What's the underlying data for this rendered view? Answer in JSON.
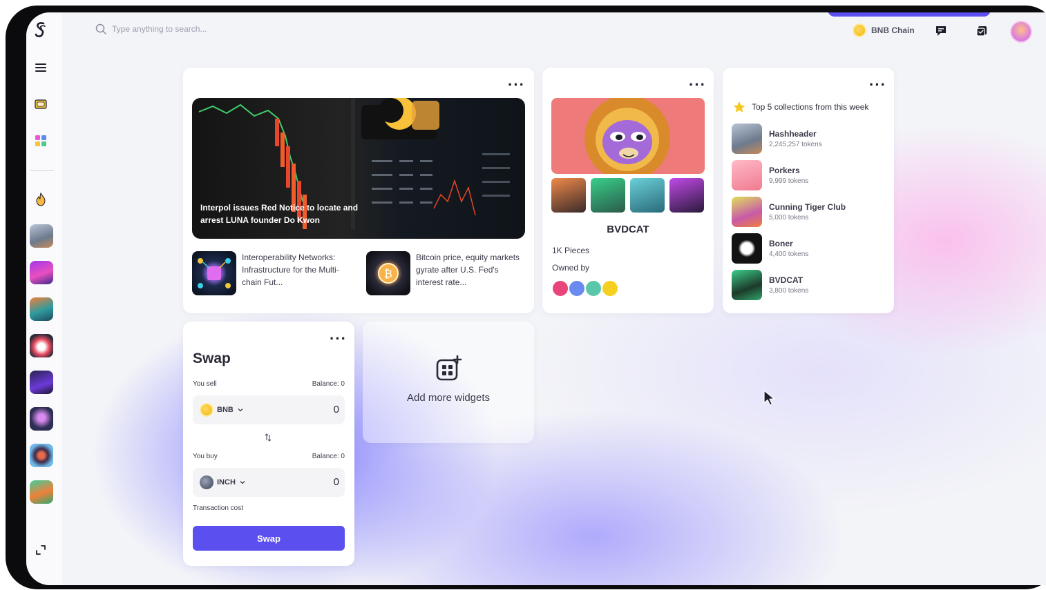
{
  "search": {
    "placeholder": "Type anything to search..."
  },
  "header": {
    "chain_label": "BNB Chain"
  },
  "news": {
    "headline": "Interpol issues Red Notice to locate and arrest LUNA founder Do Kwon",
    "items": [
      {
        "title": "Interoperability Networks: Infrastructure for the Multi-chain Fut..."
      },
      {
        "title": "Bitcoin price, equity markets gyrate after U.S. Fed's interest rate..."
      }
    ]
  },
  "nft": {
    "name": "BVDCAT",
    "pieces": "1K Pieces",
    "owned_by_label": "Owned by"
  },
  "collections": {
    "heading": "Top 5 collections from this week",
    "items": [
      {
        "name": "Hashheader",
        "tokens": "2,245,257 tokens",
        "color": "#8a95a8"
      },
      {
        "name": "Porkers",
        "tokens": "9,999 tokens",
        "color": "#f4a3b0"
      },
      {
        "name": "Cunning Tiger Club",
        "tokens": "5,000 tokens",
        "color": "#c9d05a"
      },
      {
        "name": "Boner",
        "tokens": "4,400 tokens",
        "color": "#121212"
      },
      {
        "name": "BVDCAT",
        "tokens": "3,800 tokens",
        "color": "#2fa56a"
      }
    ]
  },
  "swap": {
    "title": "Swap",
    "sell_label": "You sell",
    "sell_balance": "Balance: 0",
    "sell_token": "BNB",
    "sell_amount": "0",
    "buy_label": "You buy",
    "buy_balance": "Balance: 0",
    "buy_token": "INCH",
    "buy_amount": "0",
    "cost_label": "Transaction cost",
    "button_label": "Swap"
  },
  "widgets": {
    "add_label": "Add more widgets"
  },
  "colors": {
    "accent": "#5b4ff0",
    "bnb": "#f0b90b"
  }
}
